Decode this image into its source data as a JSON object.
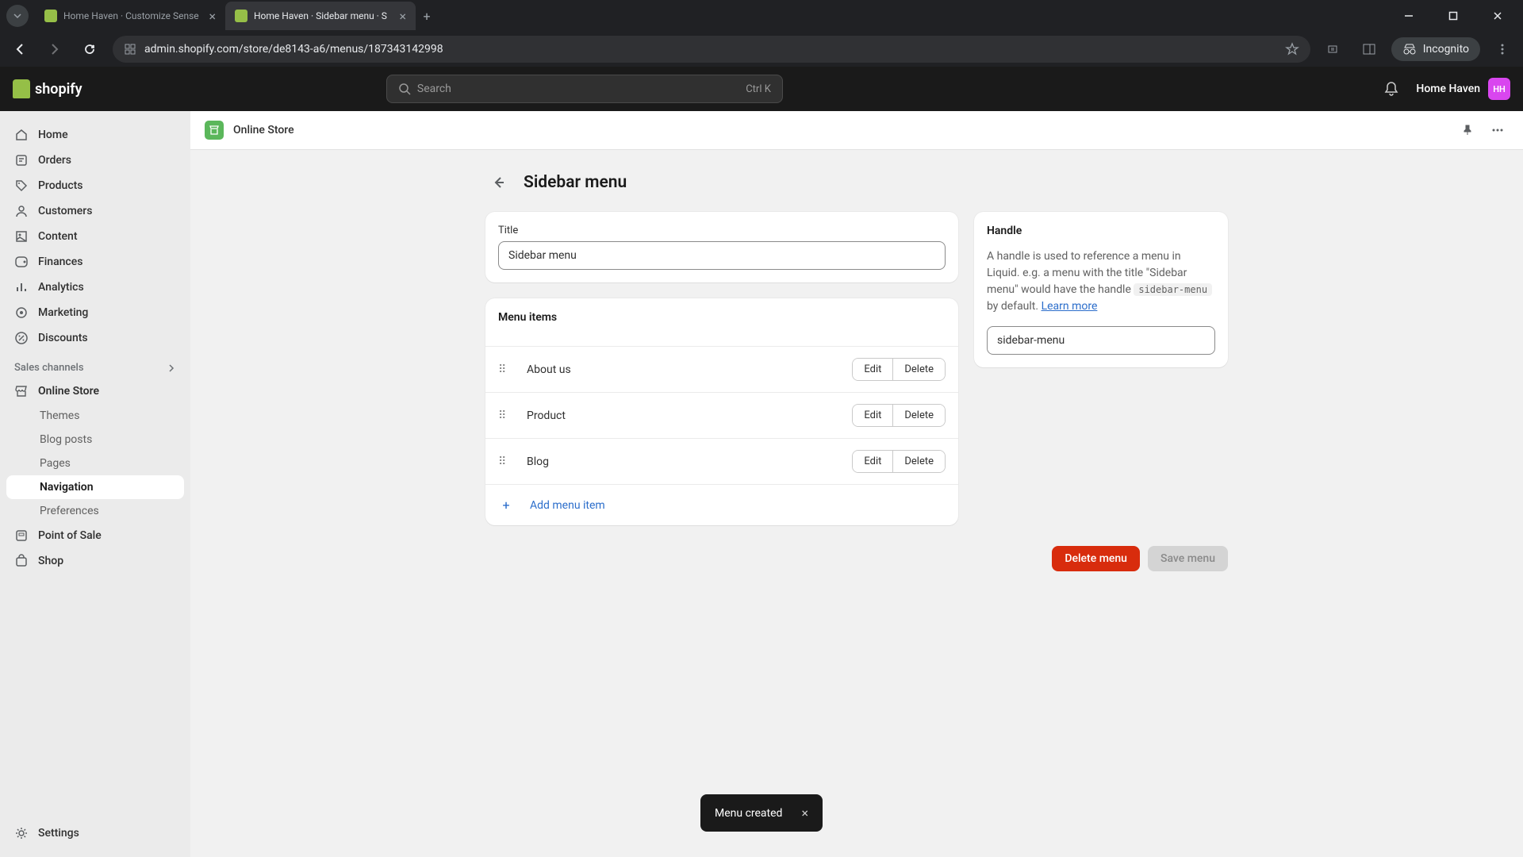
{
  "browser": {
    "tabs": [
      {
        "title": "Home Haven · Customize Sense"
      },
      {
        "title": "Home Haven · Sidebar menu · S"
      }
    ],
    "url": "admin.shopify.com/store/de8143-a6/menus/187343142998",
    "incognito_label": "Incognito"
  },
  "header": {
    "logo_text": "shopify",
    "search_placeholder": "Search",
    "search_shortcut": "Ctrl K",
    "store_name": "Home Haven",
    "store_initials": "HH"
  },
  "sidebar": {
    "items": [
      {
        "label": "Home"
      },
      {
        "label": "Orders"
      },
      {
        "label": "Products"
      },
      {
        "label": "Customers"
      },
      {
        "label": "Content"
      },
      {
        "label": "Finances"
      },
      {
        "label": "Analytics"
      },
      {
        "label": "Marketing"
      },
      {
        "label": "Discounts"
      }
    ],
    "channels_heading": "Sales channels",
    "online_store_label": "Online Store",
    "online_store_children": [
      {
        "label": "Themes"
      },
      {
        "label": "Blog posts"
      },
      {
        "label": "Pages"
      },
      {
        "label": "Navigation"
      },
      {
        "label": "Preferences"
      }
    ],
    "pos_label": "Point of Sale",
    "shop_label": "Shop",
    "settings_label": "Settings"
  },
  "context": {
    "title": "Online Store"
  },
  "page": {
    "title": "Sidebar menu",
    "title_field_label": "Title",
    "title_field_value": "Sidebar menu",
    "menu_items_heading": "Menu items",
    "items": [
      {
        "label": "About us"
      },
      {
        "label": "Product"
      },
      {
        "label": "Blog"
      }
    ],
    "edit_label": "Edit",
    "delete_label": "Delete",
    "add_item_label": "Add menu item",
    "handle": {
      "heading": "Handle",
      "desc_prefix": "A handle is used to reference a menu in Liquid. e.g. a menu with the title \"Sidebar menu\" would have the handle ",
      "desc_code": "sidebar-menu",
      "desc_suffix": " by default. ",
      "learn_more": "Learn more",
      "value": "sidebar-menu"
    },
    "actions": {
      "delete": "Delete menu",
      "save": "Save menu"
    }
  },
  "toast": {
    "message": "Menu created"
  }
}
